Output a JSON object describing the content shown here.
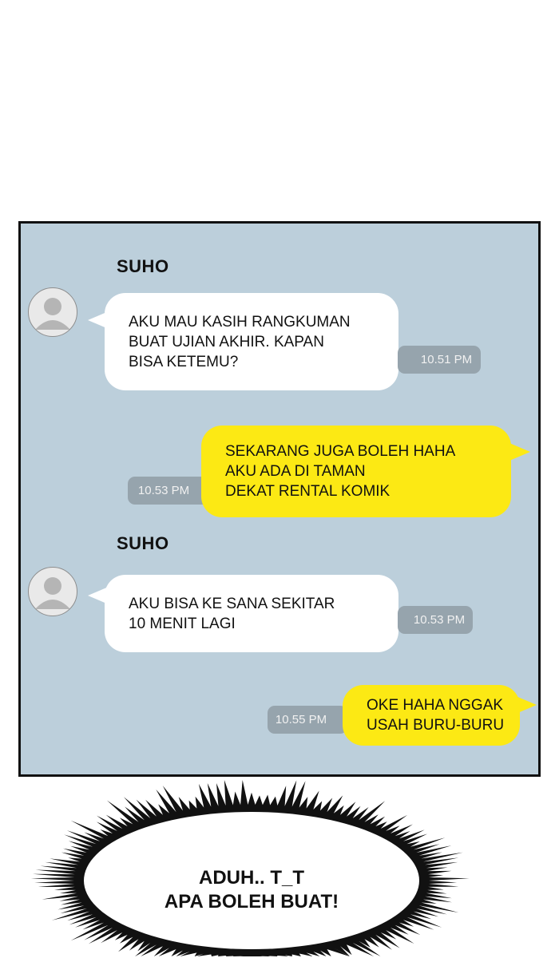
{
  "chat": {
    "messages": [
      {
        "sender": "SUHO",
        "lines": [
          "AKU MAU KASIH RANGKUMAN",
          "BUAT UJIAN AKHIR. KAPAN",
          "BISA KETEMU?"
        ],
        "time": "10.51 PM"
      },
      {
        "sender": "",
        "lines": [
          "SEKARANG JUGA BOLEH HAHA",
          "AKU ADA DI TAMAN",
          "DEKAT RENTAL KOMIK"
        ],
        "time": "10.53 PM"
      },
      {
        "sender": "SUHO",
        "lines": [
          "AKU BISA KE SANA SEKITAR",
          "10 MENIT LAGI"
        ],
        "time": "10.53 PM"
      },
      {
        "sender": "",
        "lines": [
          "OKE HAHA NGGAK",
          "USAH BURU-BURU"
        ],
        "time": "10.55 PM"
      }
    ]
  },
  "caption": {
    "lines": [
      "ADUH.. T_T",
      "APA BOLEH BUAT!"
    ]
  },
  "colors": {
    "chat_background": "#bccfdb",
    "incoming_bubble": "#ffffff",
    "outgoing_bubble": "#fce914",
    "timestamp_badge": "#96a4ad"
  },
  "icons": {
    "avatar": "default-user-avatar-icon"
  }
}
